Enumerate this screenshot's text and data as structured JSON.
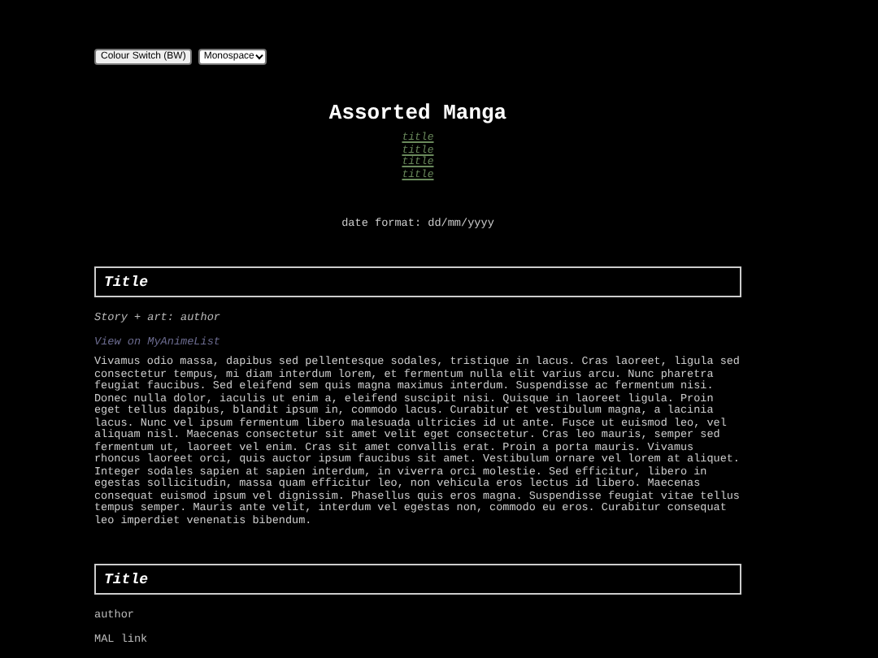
{
  "controls": {
    "colour_button": "Colour Switch (BW)",
    "font_select": "Monospace"
  },
  "title": "Assorted Manga",
  "index_links": [
    "title",
    "title",
    "title",
    "title"
  ],
  "date_format": "date format: dd/mm/yyyy",
  "entries": [
    {
      "kind": "detailed",
      "title": "Title",
      "credit": "Story + art: author",
      "link": "View on MyAnimeList",
      "description": "Vivamus odio massa, dapibus sed pellentesque sodales, tristique in lacus. Cras laoreet, ligula sed consectetur tempus, mi diam interdum lorem, et fermentum nulla elit varius arcu. Nunc pharetra feugiat faucibus. Sed eleifend sem quis magna maximus interdum. Suspendisse ac fermentum nisi. Donec nulla dolor, iaculis ut enim a, eleifend suscipit nisi. Quisque in laoreet ligula. Proin eget tellus dapibus, blandit ipsum in, commodo lacus. Curabitur et vestibulum magna, a lacinia lacus. Nunc vel ipsum fermentum libero malesuada ultricies id ut ante. Fusce ut euismod leo, vel aliquam nisl. Maecenas consectetur sit amet velit eget consectetur. Cras leo mauris, semper sed fermentum ut, laoreet vel enim. Cras sit amet convallis erat. Proin a porta mauris. Vivamus rhoncus laoreet orci, quis auctor ipsum faucibus sit amet. Vestibulum ornare vel lorem at aliquet. Integer sodales sapien at sapien interdum, in viverra orci molestie. Sed efficitur, libero in egestas sollicitudin, massa quam efficitur leo, non vehicula eros lectus id libero. Maecenas consequat euismod ipsum vel dignissim. Phasellus quis eros magna. Suspendisse feugiat vitae tellus tempus semper. Mauris ante velit, interdum vel egestas non, commodo eu eros. Curabitur consequat leo imperdiet venenatis bibendum."
    },
    {
      "kind": "plain",
      "title": "Title",
      "credit": "author",
      "link": "MAL link"
    }
  ]
}
